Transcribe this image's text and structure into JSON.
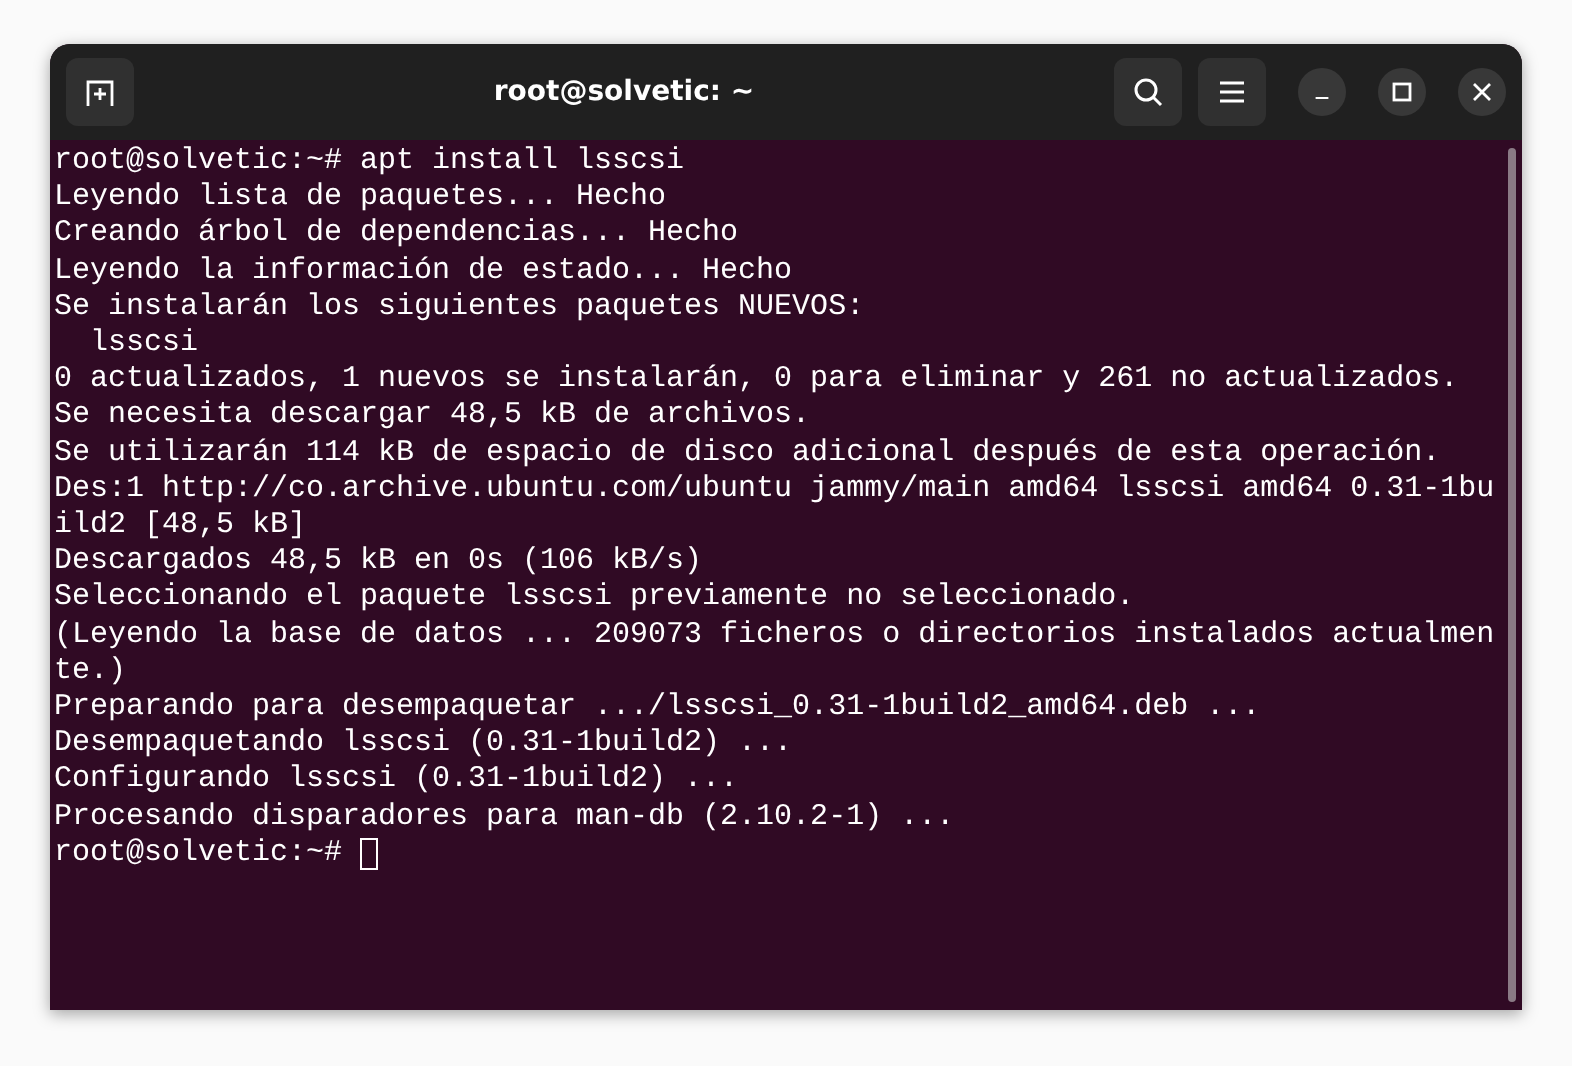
{
  "window": {
    "title": "root@solvetic: ~"
  },
  "terminal": {
    "lines": [
      "root@solvetic:~# apt install lsscsi",
      "Leyendo lista de paquetes... Hecho",
      "Creando árbol de dependencias... Hecho",
      "Leyendo la información de estado... Hecho",
      "Se instalarán los siguientes paquetes NUEVOS:",
      "  lsscsi",
      "0 actualizados, 1 nuevos se instalarán, 0 para eliminar y 261 no actualizados.",
      "Se necesita descargar 48,5 kB de archivos.",
      "Se utilizarán 114 kB de espacio de disco adicional después de esta operación.",
      "Des:1 http://co.archive.ubuntu.com/ubuntu jammy/main amd64 lsscsi amd64 0.31-1bu",
      "ild2 [48,5 kB]",
      "Descargados 48,5 kB en 0s (106 kB/s)",
      "Seleccionando el paquete lsscsi previamente no seleccionado.",
      "(Leyendo la base de datos ... 209073 ficheros o directorios instalados actualmen",
      "te.)",
      "Preparando para desempaquetar .../lsscsi_0.31-1build2_amd64.deb ...",
      "Desempaquetando lsscsi (0.31-1build2) ...",
      "Configurando lsscsi (0.31-1build2) ...",
      "Procesando disparadores para man-db (2.10.2-1) ..."
    ],
    "prompt": "root@solvetic:~# "
  }
}
